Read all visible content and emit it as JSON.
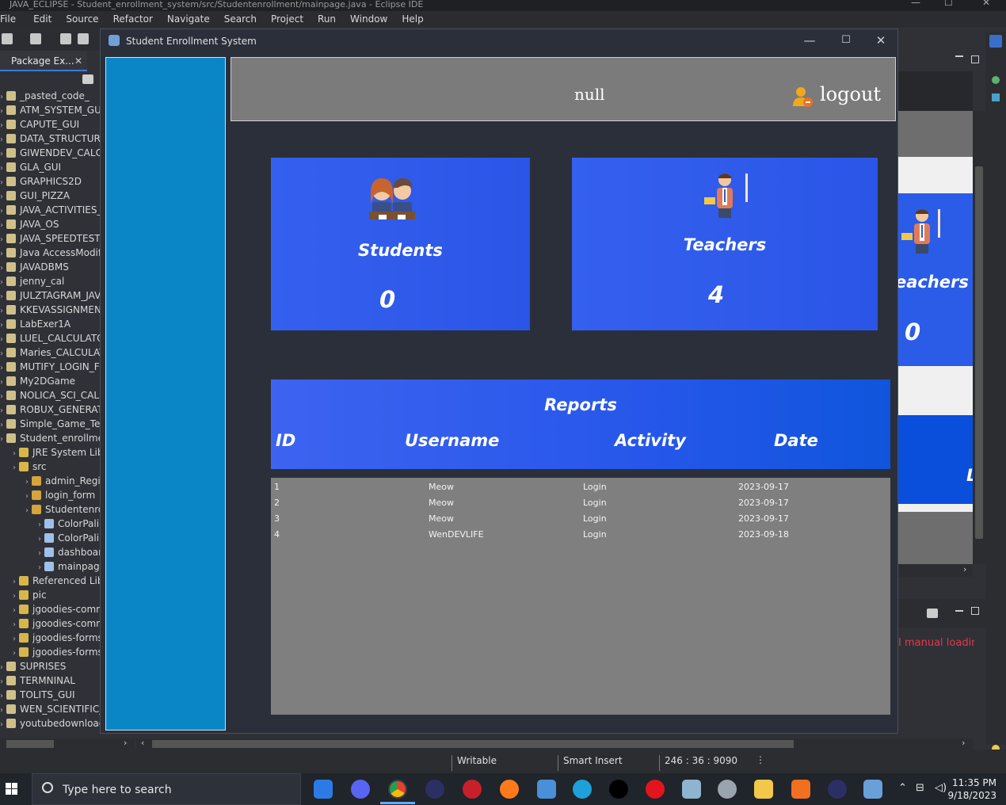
{
  "eclipse": {
    "title": "JAVA_ECLIPSE - Student_enrollment_system/src/Studentenrollment/mainpage.java - Eclipse IDE",
    "menu": [
      "File",
      "Edit",
      "Source",
      "Refactor",
      "Navigate",
      "Search",
      "Project",
      "Run",
      "Window",
      "Help"
    ],
    "package_explorer_tab": "Package Ex...",
    "tree": [
      "_pasted_code_",
      "ATM_SYSTEM_GUI",
      "CAPUTE_GUI",
      "DATA_STRUCTURE",
      "GIWENDEV_CALC",
      "GLA_GUI",
      "GRAPHICS2D",
      "GUI_PIZZA",
      "JAVA_ACTIVITIES_F",
      "JAVA_OS",
      "JAVA_SPEEDTEST",
      "Java AccessModifi",
      "JAVADBMS",
      "jenny_cal",
      "JULZTAGRAM_JAV",
      "KKEVASSIGNMENT",
      "LabExer1A",
      "LUEL_CALCULATO",
      "Maries_CALCULAT",
      "MUTIFY_LOGIN_FO",
      "My2DGame",
      "NOLICA_SCI_CAL",
      "ROBUX_GENERATO",
      "Simple_Game_Tex",
      "Student_enrollme",
      "JRE System Libr",
      "src",
      "admin_Regi",
      "login_form",
      "Studentenro",
      "ColorPali",
      "ColorPali",
      "dashboar",
      "mainpag",
      "Referenced Lib",
      "pic",
      "jgoodies-comm",
      "jgoodies-comm",
      "jgoodies-forms",
      "jgoodies-forms",
      "SUPRISES",
      "TERMNINAL",
      "TOLITS_GUI",
      "WEN_SCIENTIFIC_",
      "youtubedownload"
    ],
    "console_text": "I manual loadin",
    "status": {
      "writable": "Writable",
      "insert_mode": "Smart Insert",
      "position": "246 : 36 : 9090"
    }
  },
  "taskbar": {
    "search_placeholder": "Type here to search",
    "time": "11:35 PM",
    "date": "9/18/2023"
  },
  "app": {
    "title": "Student Enrollment System",
    "header": {
      "username": "null",
      "logout_label": "logout"
    },
    "cards": {
      "students": {
        "label": "Students",
        "count": "0"
      },
      "teachers": {
        "label": "Teachers",
        "count": "4"
      }
    },
    "behind": {
      "teachers_partial": "eachers",
      "count": "0",
      "letter": "L"
    },
    "reports": {
      "title": "Reports",
      "columns": [
        "ID",
        "Username",
        "Activity",
        "Date"
      ],
      "rows": [
        [
          "1",
          "Meow",
          "Login",
          "2023-09-17"
        ],
        [
          "2",
          "Meow",
          "Login",
          "2023-09-17"
        ],
        [
          "3",
          "Meow",
          "Login",
          "2023-09-17"
        ],
        [
          "4",
          "WenDEVLIFE",
          "Login",
          "2023-09-18"
        ]
      ]
    }
  },
  "colors": {
    "sidebar": "#0a86c6",
    "card_blue": "#3560ef",
    "header_gray": "#7b7b7b",
    "window_bg": "#2b2f3a"
  }
}
